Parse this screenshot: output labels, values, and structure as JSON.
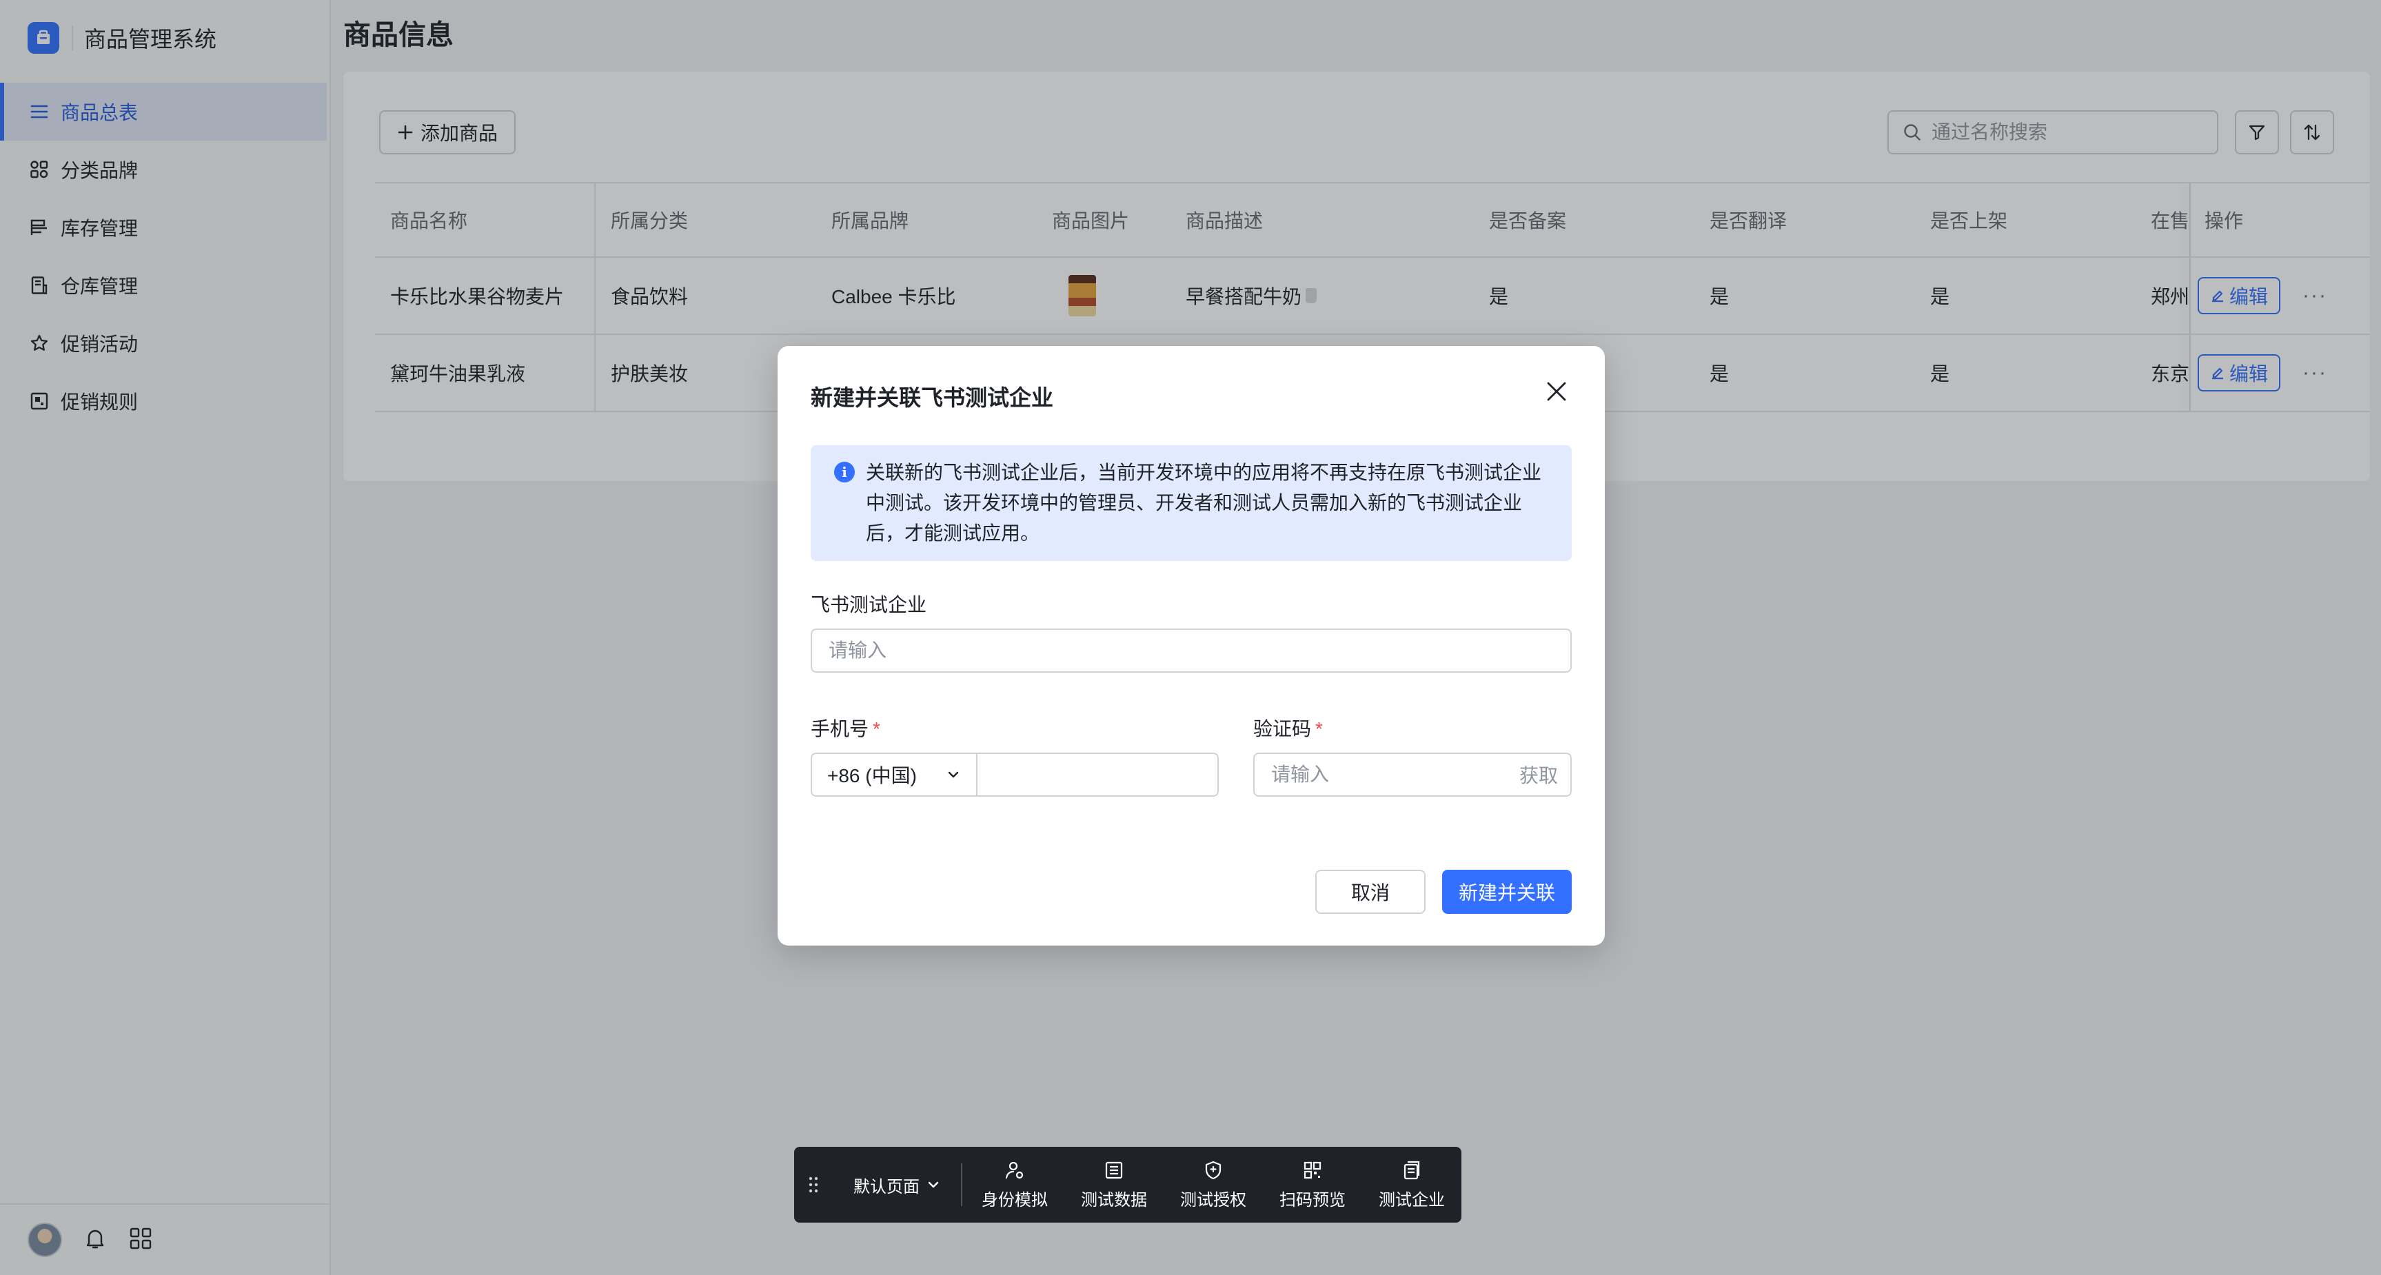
{
  "app": {
    "title": "商品管理系统"
  },
  "sidebar": {
    "items": [
      {
        "label": "商品总表",
        "icon": "list-icon",
        "active": true
      },
      {
        "label": "分类品牌",
        "icon": "grid-icon"
      },
      {
        "label": "库存管理",
        "icon": "inventory-icon"
      },
      {
        "label": "仓库管理",
        "icon": "warehouse-icon"
      },
      {
        "label": "促销活动",
        "icon": "star-icon"
      },
      {
        "label": "促销规则",
        "icon": "rule-icon"
      }
    ]
  },
  "page": {
    "title": "商品信息"
  },
  "toolbar": {
    "add_label": "添加商品",
    "search_placeholder": "通过名称搜索"
  },
  "table": {
    "columns": [
      "商品名称",
      "所属分类",
      "所属品牌",
      "商品图片",
      "商品描述",
      "是否备案",
      "是否翻译",
      "是否上架",
      "在售",
      "操作"
    ],
    "rows": [
      {
        "name": "卡乐比水果谷物麦片",
        "category": "食品饮料",
        "brand": "Calbee 卡乐比",
        "description": "早餐搭配牛奶",
        "filed": "是",
        "translated": "是",
        "listed": "是",
        "location": "郑州",
        "edit_label": "编辑"
      },
      {
        "name": "黛珂牛油果乳液",
        "category": "护肤美妆",
        "brand": "",
        "description": "",
        "filed": "",
        "translated": "是",
        "listed": "是",
        "location": "东京",
        "edit_label": "编辑"
      }
    ]
  },
  "modal": {
    "title": "新建并关联飞书测试企业",
    "notice": "关联新的飞书测试企业后，当前开发环境中的应用将不再支持在原飞书测试企业中测试。该开发环境中的管理员、开发者和测试人员需加入新的飞书测试企业后，才能测试应用。",
    "company_label": "飞书测试企业",
    "company_placeholder": "请输入",
    "phone_label": "手机号",
    "required_mark": "*",
    "country_code": "+86 (中国)",
    "code_label": "验证码",
    "code_placeholder": "请输入",
    "get_code_label": "获取",
    "cancel_label": "取消",
    "submit_label": "新建并关联"
  },
  "dev_toolbar": {
    "page_select": "默认页面",
    "items": [
      {
        "label": "身份模拟",
        "icon": "user-switch-icon"
      },
      {
        "label": "测试数据",
        "icon": "data-list-icon"
      },
      {
        "label": "测试授权",
        "icon": "shield-icon"
      },
      {
        "label": "扫码预览",
        "icon": "qrcode-icon"
      },
      {
        "label": "测试企业",
        "icon": "company-doc-icon"
      }
    ]
  },
  "colors": {
    "accent": "#3370ff",
    "required": "#f54a45",
    "toolbar_bg": "#1f2329"
  }
}
